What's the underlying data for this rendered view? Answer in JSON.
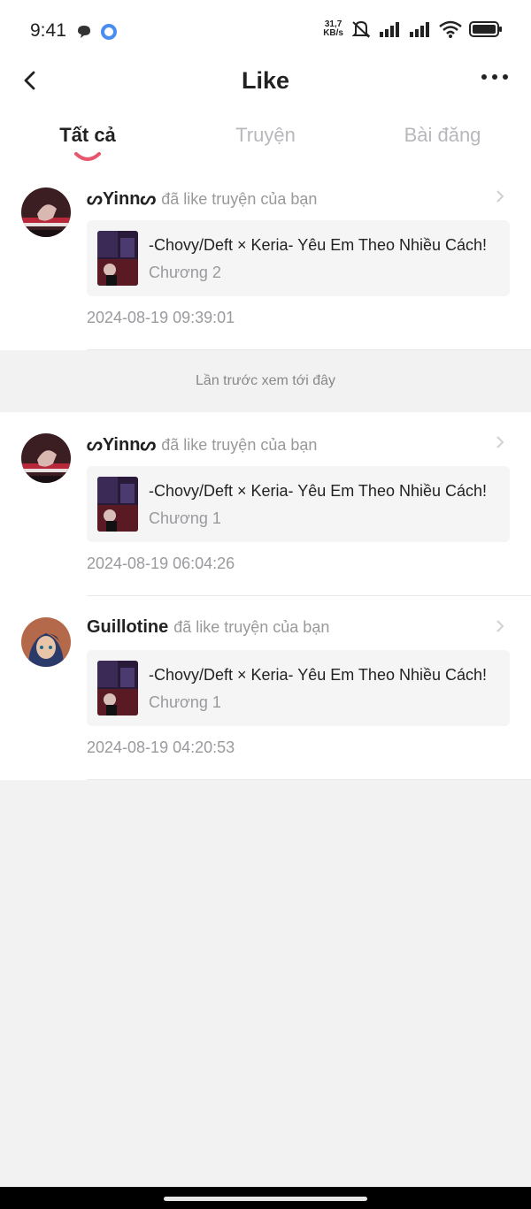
{
  "status_bar": {
    "time": "9:41",
    "net_speed_value": "31,7",
    "net_speed_unit": "KB/s",
    "battery_icon": "battery-icon",
    "wifi_icon": "wifi-icon"
  },
  "header": {
    "title": "Like",
    "back_icon": "chevron-left-icon",
    "more_icon": "more-horizontal-icon"
  },
  "tabs": [
    {
      "label": "Tất cả",
      "active": true
    },
    {
      "label": "Truyện",
      "active": false
    },
    {
      "label": "Bài đăng",
      "active": false
    }
  ],
  "accent_color": "#e8566e",
  "notifications": [
    {
      "user": "ᔕYinnᔕ",
      "action": "đã like truyện của bạn",
      "story_title": "-Chovy/Deft × Keria- Yêu Em Theo Nhiều Cách!",
      "chapter": "Chương 2",
      "time": "2024-08-19 09:39:01"
    },
    {
      "user": "ᔕYinnᔕ",
      "action": "đã like truyện của bạn",
      "story_title": "-Chovy/Deft × Keria- Yêu Em Theo Nhiều Cách!",
      "chapter": "Chương 1",
      "time": "2024-08-19 06:04:26"
    },
    {
      "user": "Guillotine",
      "action": "đã like truyện của bạn",
      "story_title": "-Chovy/Deft × Keria- Yêu Em Theo Nhiều Cách!",
      "chapter": "Chương 1",
      "time": "2024-08-19 04:20:53"
    }
  ],
  "last_seen_label": "Lần trước xem tới đây"
}
